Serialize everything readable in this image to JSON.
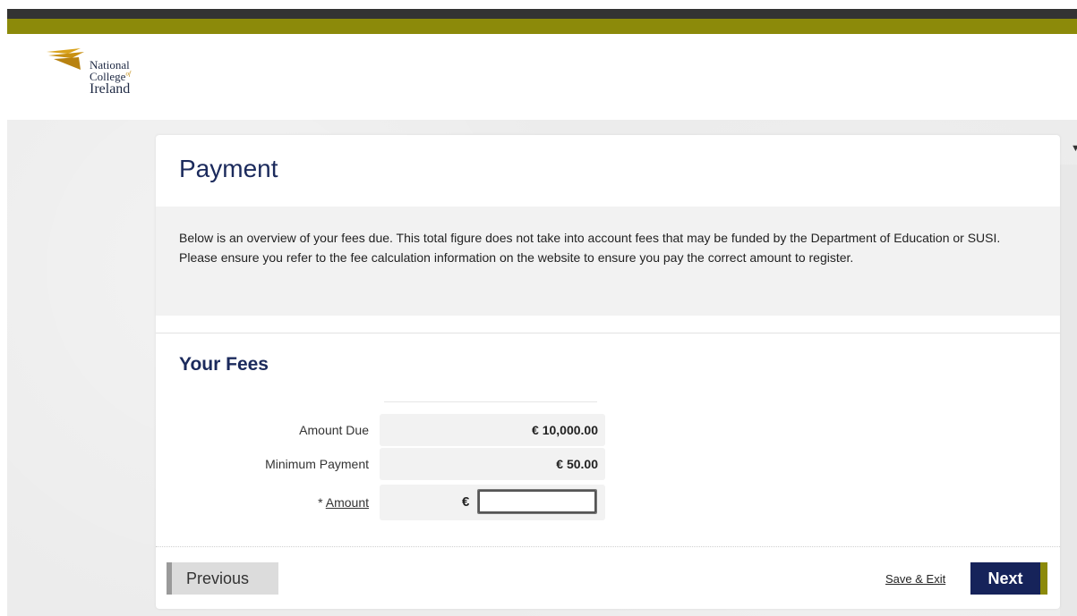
{
  "logo": {
    "line1": "National",
    "line2": "College",
    "line2_sup": "of",
    "line3": "Ireland"
  },
  "page": {
    "title": "Payment",
    "info": "Below is an overview of your fees due. This total figure does not take into account fees that may be funded by the Department of Education or SUSI. Please ensure you refer to the fee calculation information on the website to ensure you pay the correct amount to register."
  },
  "fees": {
    "section_title": "Your Fees",
    "amount_due_label": "Amount Due",
    "amount_due_value": "€ 10,000.00",
    "min_payment_label": "Minimum Payment",
    "min_payment_value": "€ 50.00",
    "amount_required_marker": "*",
    "amount_label": "Amount",
    "currency_symbol": "€",
    "amount_value": ""
  },
  "nav": {
    "previous_label": "Previous",
    "save_exit_label": "Save & Exit",
    "next_label": "Next"
  },
  "colors": {
    "brand_navy": "#16235a",
    "brand_olive": "#8c8a0a",
    "topbar_dark": "#333333"
  }
}
